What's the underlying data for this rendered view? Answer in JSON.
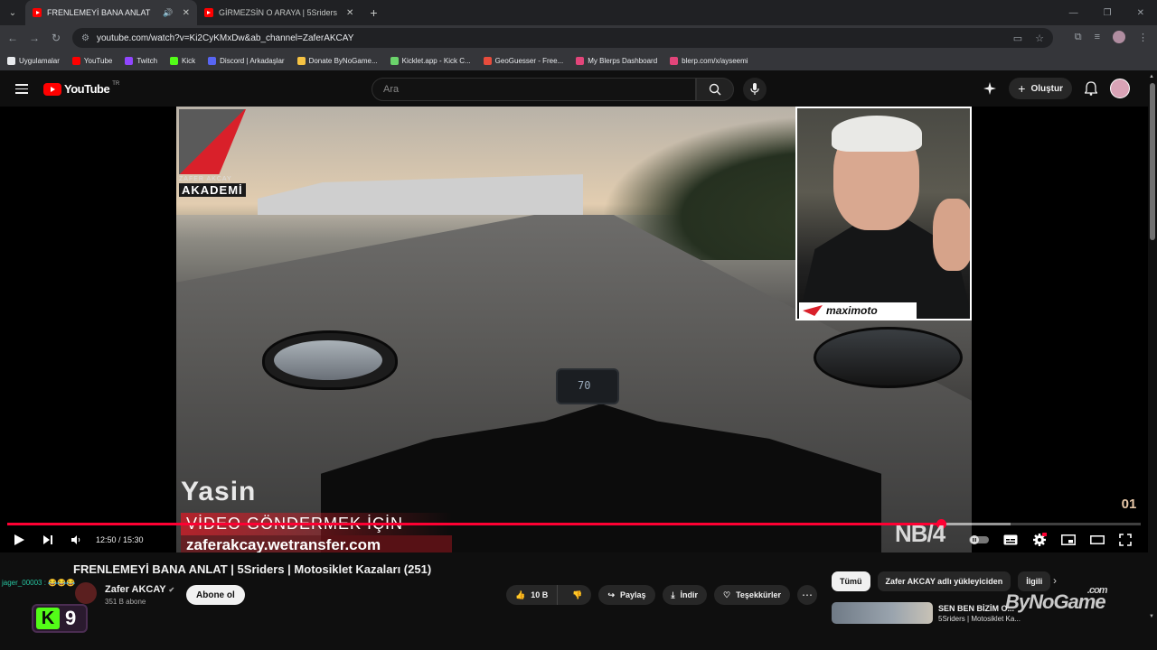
{
  "browser": {
    "tabs": [
      {
        "title": "FRENLEMEYİ BANA ANLAT",
        "active": true,
        "playing_audio": true
      },
      {
        "title": "GİRMEZSİN O ARAYA | 5Sriders",
        "active": false
      }
    ],
    "url": "youtube.com/watch?v=Ki2CyKMxDw&ab_channel=ZaferAKCAY",
    "bookmarks": [
      {
        "label": "Uygulamalar",
        "color": "#e8eaed"
      },
      {
        "label": "YouTube",
        "color": "#ff0000"
      },
      {
        "label": "Twitch",
        "color": "#9146ff"
      },
      {
        "label": "Kick",
        "color": "#53fc18"
      },
      {
        "label": "Discord | Arkadaşlar",
        "color": "#5865f2"
      },
      {
        "label": "Donate ByNoGame...",
        "color": "#f6c343"
      },
      {
        "label": "Kicklet.app - Kick C...",
        "color": "#6bd36b"
      },
      {
        "label": "GeoGuesser - Free...",
        "color": "#e74c3c"
      },
      {
        "label": "My Blerps Dashboard",
        "color": "#e2457a"
      },
      {
        "label": "blerp.com/x/ayseemi",
        "color": "#e2457a"
      }
    ]
  },
  "youtube": {
    "logo_text": "YouTube",
    "country": "TR",
    "search_placeholder": "Ara",
    "create_label": "Oluştur"
  },
  "video": {
    "overlay_brand": "ZAFER AKCAY",
    "overlay_akademi": "AKADEMİ",
    "pip_brand": "maximoto",
    "speedometer": "70",
    "lower_third_name": "Yasin",
    "lower_third_line1": "VİDEO GÖNDERMEK İÇİN",
    "lower_third_line2": "zaferakcay.wetransfer.com",
    "corner_badge": "NB/4",
    "abone_badge": "01",
    "time": "12:50 / 15:30",
    "progress": 0.824,
    "buffered": 0.885
  },
  "details": {
    "title": "FRENLEMEYİ BANA ANLAT | 5Sriders | Motosiklet Kazaları (251)",
    "chat_user": "jager_00003 :",
    "chat_msg": "😂😂😂",
    "channel_name": "Zafer AKCAY",
    "subscribers": "351 B abone",
    "subscribe_label": "Abone ol",
    "likes": "10 B",
    "share_label": "Paylaş",
    "download_label": "İndir",
    "thanks_label": "Teşekkürler",
    "kick_number": "9",
    "watermark": "ByNoGame",
    "watermark_tld": ".com"
  },
  "recommendations": {
    "chips": [
      "Tümü",
      "Zafer AKCAY adlı yükleyiciden",
      "İlgili"
    ],
    "first_title": "SEN BEN BİZİM O...",
    "first_sub": "5Sriders | Motosiklet Ka..."
  },
  "colors": {
    "accent": "#ff0033",
    "background": "#0f0f0f",
    "kick_green": "#53fc18"
  }
}
